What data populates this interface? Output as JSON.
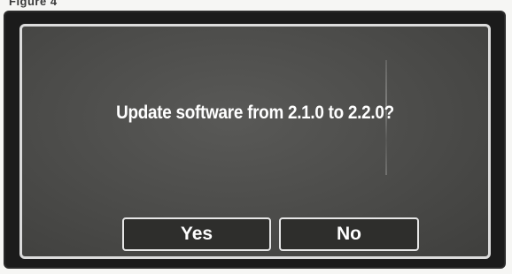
{
  "caption": "Figure 4",
  "dialog": {
    "message": "Update software from 2.1.0  to 2.2.0?",
    "yes_label": "Yes",
    "no_label": "No"
  },
  "colors": {
    "dialog_background": "#4a4a48",
    "dialog_border": "#dcdcdc",
    "text": "#ffffff"
  }
}
